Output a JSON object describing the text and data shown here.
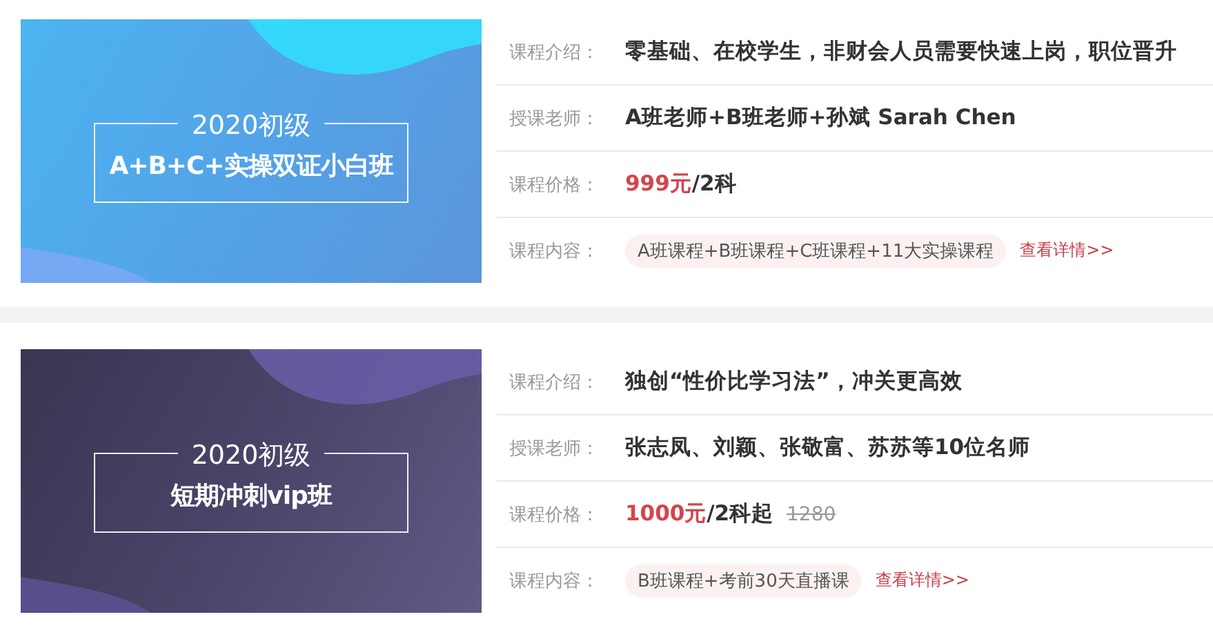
{
  "courses": [
    {
      "banner": {
        "kind": "blue",
        "year_level": "2020初级",
        "name": "A+B+C+实操双证小白班"
      },
      "intro_label": "课程介绍：",
      "intro": "零基础、在校学生，非财会人员需要快速上岗，职位晋升",
      "teacher_label": "授课老师：",
      "teachers": "A班老师+B班老师+孙斌 Sarah Chen",
      "price_label": "课程价格：",
      "price": {
        "amount": "999元",
        "unit": "/2科"
      },
      "content_label": "课程内容：",
      "content": "A班课程+B班课程+C班课程+11大实操课程",
      "details_link": "查看详情>>"
    },
    {
      "banner": {
        "kind": "purple",
        "year_level": "2020初级",
        "name": "短期冲刺vip班"
      },
      "intro_label": "课程介绍：",
      "intro": "独创“性价比学习法”，冲关更高效",
      "teacher_label": "授课老师：",
      "teachers": "张志凤、刘颖、张敬富、苏苏等10位名师",
      "price_label": "课程价格：",
      "price": {
        "amount": "1000元",
        "unit": "/2科起",
        "original": "1280"
      },
      "content_label": "课程内容：",
      "content": "B班课程+考前30天直播课",
      "details_link": "查看详情>>"
    }
  ]
}
